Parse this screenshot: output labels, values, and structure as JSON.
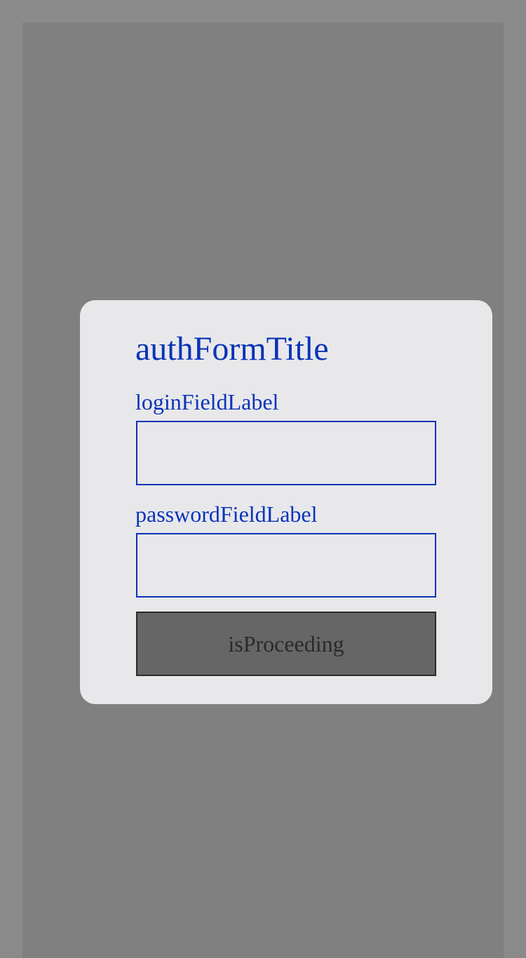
{
  "auth_form": {
    "title": "authFormTitle",
    "login_label": "loginFieldLabel",
    "login_value": "",
    "password_label": "passwordFieldLabel",
    "password_value": "",
    "submit_label": "isProceeding"
  },
  "colors": {
    "page_background": "#8a8a8a",
    "backdrop": "#808080",
    "card_background": "#e8e8eb",
    "accent": "#0a33b8",
    "button_background": "#666666",
    "button_border": "#2a2a2a"
  }
}
